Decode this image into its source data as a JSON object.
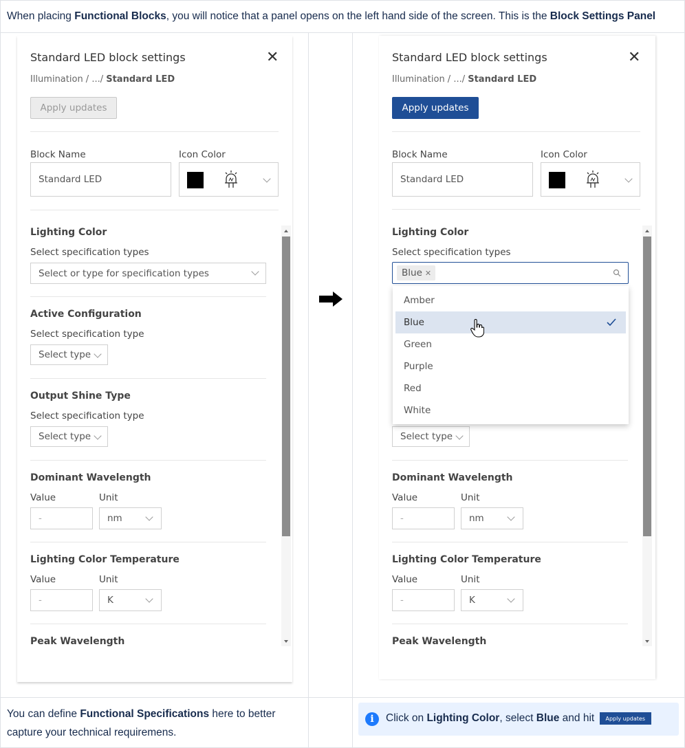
{
  "intro": {
    "part1": "When placing ",
    "bold1": "Functional Blocks",
    "part2": ", you will notice that a panel opens on the left hand side of the screen. This is the ",
    "bold2": "Block Settings Panel"
  },
  "panel": {
    "title": "Standard LED block settings",
    "breadcrumb_prefix": "Illumination / .../ ",
    "breadcrumb_current": "Standard LED",
    "apply_label": "Apply updates",
    "block_name_label": "Block Name",
    "block_name_value": "Standard LED",
    "icon_color_label": "Icon Color",
    "icon_color": "#000000",
    "lighting_color": {
      "title": "Lighting Color",
      "label": "Select specification types",
      "placeholder": "Select or type for specification types"
    },
    "active_config": {
      "title": "Active Configuration",
      "label": "Select specification type",
      "value": "Select type"
    },
    "output_shine": {
      "title": "Output Shine Type",
      "label": "Select specification type",
      "value": "Select type"
    },
    "dominant_wavelength": {
      "title": "Dominant Wavelength",
      "value_label": "Value",
      "unit_label": "Unit",
      "value": "-",
      "unit": "nm"
    },
    "color_temp": {
      "title": "Lighting Color Temperature",
      "value_label": "Value",
      "unit_label": "Unit",
      "value": "-",
      "unit": "K"
    },
    "peak_wavelength": {
      "title": "Peak Wavelength"
    }
  },
  "dropdown": {
    "selected_tag": "Blue",
    "options": [
      "Amber",
      "Blue",
      "Green",
      "Purple",
      "Red",
      "White"
    ],
    "selected_option": "Blue"
  },
  "footer": {
    "left_part1": "You can define ",
    "left_bold": "Functional Specifications",
    "left_part2": " here to better capture your technical requiremens.",
    "note_part1": "Click on ",
    "note_bold1": "Lighting Color",
    "note_part2": ", select ",
    "note_bold2": "Blue",
    "note_part3": " and hit ",
    "note_button": "Apply updates"
  }
}
